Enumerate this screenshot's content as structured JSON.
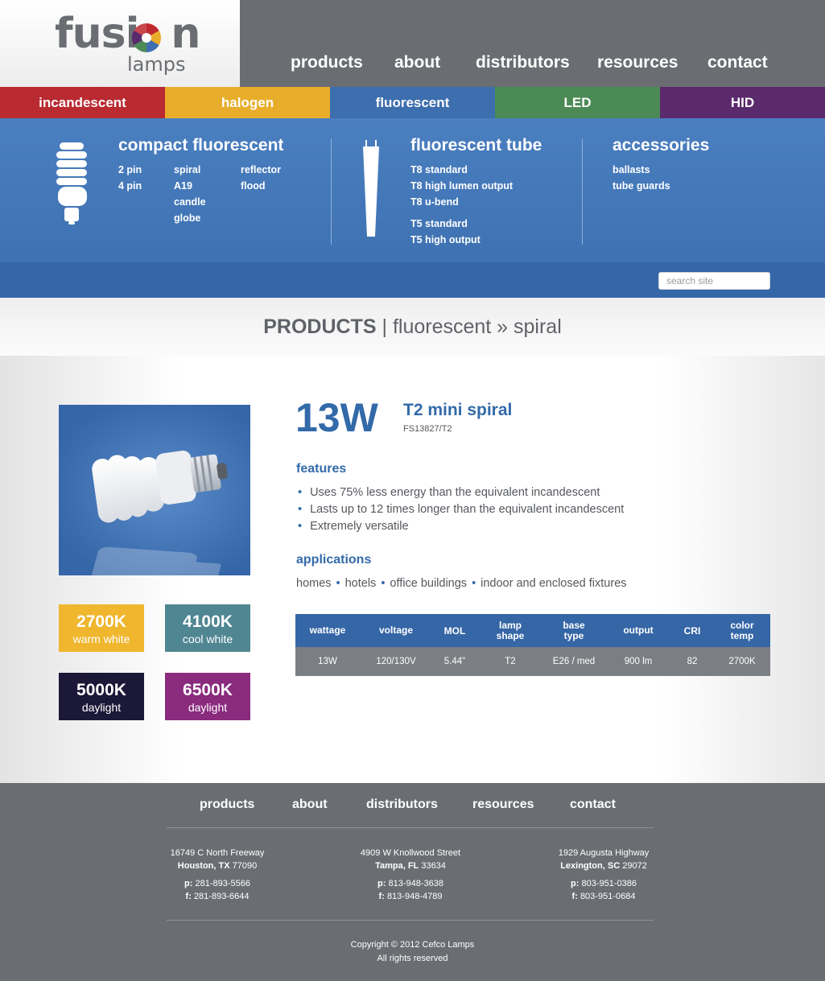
{
  "logo": {
    "word_start": "fusi",
    "word_end": "n",
    "sub": "lamps"
  },
  "topnav": [
    "products",
    "about",
    "distributors",
    "resources",
    "contact"
  ],
  "categories": [
    {
      "label": "incandescent",
      "color": "#b92a31"
    },
    {
      "label": "halogen",
      "color": "#e8ae2b"
    },
    {
      "label": "fluorescent",
      "color": "#3d6eae"
    },
    {
      "label": "LED",
      "color": "#4c8a55"
    },
    {
      "label": "HID",
      "color": "#5b2a6d"
    }
  ],
  "mega": {
    "compact": {
      "title": "compact fluorescent",
      "col1": [
        "2 pin",
        "4 pin"
      ],
      "col2": [
        "spiral",
        "A19",
        "candle",
        "globe"
      ],
      "col3": [
        "reflector",
        "flood"
      ]
    },
    "tube": {
      "title": "fluorescent tube",
      "group1": [
        "T8 standard",
        "T8 high lumen output",
        "T8 u-bend"
      ],
      "group2": [
        "T5 standard",
        "T5 high output"
      ]
    },
    "accessories": {
      "title": "accessories",
      "items": [
        "ballasts",
        "tube guards"
      ]
    }
  },
  "search": {
    "placeholder": "search site"
  },
  "page_title": {
    "section": "PRODUCTS",
    "sep": "|",
    "path": "fluorescent » spiral"
  },
  "product": {
    "watts": "13W",
    "name": "T2 mini spiral",
    "code": "FS13827/T2",
    "features_title": "features",
    "features": [
      "Uses 75% less energy than the equivalent incandescent",
      "Lasts up to 12 times longer than the equivalent incandescent",
      "Extremely versatile"
    ],
    "bullet": "•",
    "applications_title": "applications",
    "applications": [
      "homes",
      "hotels",
      "office buildings",
      "indoor and enclosed fixtures"
    ]
  },
  "swatches": [
    {
      "k": "2700K",
      "name": "warm white",
      "color": "#f0b62e"
    },
    {
      "k": "4100K",
      "name": "cool white",
      "color": "#4f8691"
    },
    {
      "k": "5000K",
      "name": "daylight",
      "color": "#1c1838"
    },
    {
      "k": "6500K",
      "name": "daylight",
      "color": "#8a2b7e"
    }
  ],
  "specs": {
    "headers": [
      [
        "wattage"
      ],
      [
        "voltage"
      ],
      [
        "MOL"
      ],
      [
        "lamp",
        "shape"
      ],
      [
        "base",
        "type"
      ],
      [
        "output"
      ],
      [
        "CRI"
      ],
      [
        "color",
        "temp"
      ]
    ],
    "values": [
      "13W",
      "120/130V",
      "5.44\"",
      "T2",
      "E26 / med",
      "900 lm",
      "82",
      "2700K"
    ]
  },
  "footer": {
    "nav": [
      "products",
      "about",
      "distributors",
      "resources",
      "contact"
    ],
    "offices": [
      {
        "street": "16749 C North Freeway",
        "city": "Houston, TX",
        "zip": "77090",
        "phone": "281-893-5566",
        "fax": "281-893-6644"
      },
      {
        "street": "4909 W Knollwood Street",
        "city": "Tampa, FL",
        "zip": "33634",
        "phone": "813-948-3638",
        "fax": "813-948-4789"
      },
      {
        "street": "1929 Augusta Highway",
        "city": "Lexington, SC",
        "zip": "29072",
        "phone": "803-951-0386",
        "fax": "803-951-0684"
      }
    ],
    "phone_label": "p:",
    "fax_label": "f:",
    "copyright": "Copyright © 2012 Cefco Lamps",
    "rights": "All rights reserved"
  }
}
